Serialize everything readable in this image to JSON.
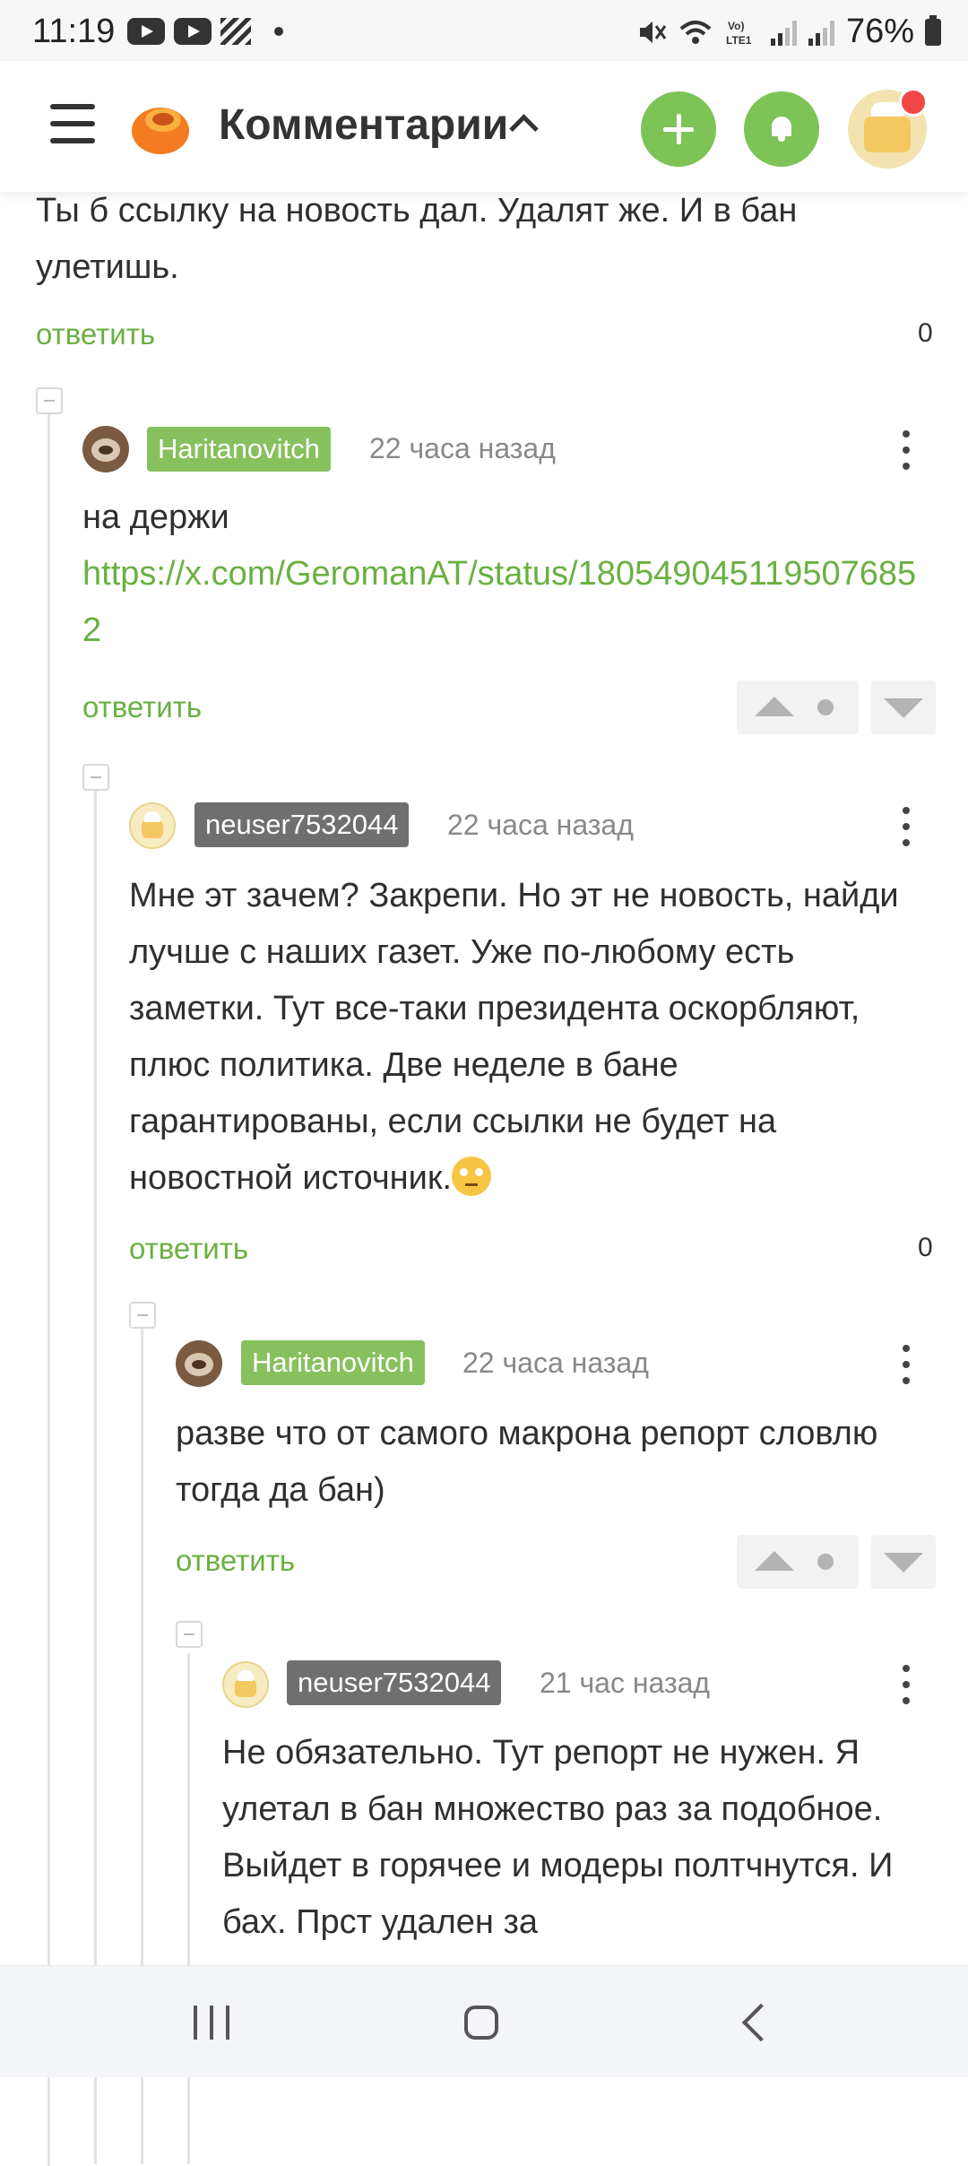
{
  "status_bar": {
    "time": "11:19",
    "battery": "76%"
  },
  "header": {
    "title": "Комментарии"
  },
  "comments": [
    {
      "text": "Ты б ссылку на новость дал. Удалят же. И в бан улетишь.",
      "reply_label": "ответить",
      "score": "0"
    },
    {
      "author": "Haritanovitch",
      "time": "22 часа назад",
      "text": "на держи",
      "link": "https://x.com/GeromanAT/status/1805490451195076852",
      "reply_label": "ответить"
    },
    {
      "author": "neuser7532044",
      "time": "22 часа назад",
      "text": "Мне эт зачем? Закрепи. Но эт не новость, найди лучше с наших газет. Уже по-любому есть заметки. Тут все-таки президента оскорбляют, плюс политика. Две неделе в бане гарантированы, если ссылки не будет на новостной источник.",
      "emoji": "face-with-rolling-eyes",
      "reply_label": "ответить",
      "score": "0"
    },
    {
      "author": "Haritanovitch",
      "time": "22 часа назад",
      "text": "разве что от самого макрона репорт словлю тогда да бан)",
      "reply_label": "ответить"
    },
    {
      "author": "neuser7532044",
      "time": "21 час назад",
      "text": "Не обязательно. Тут репорт не нужен. Я улетал в бан множество раз за подобное. Выйдет в горячее и модеры полтчнутся. И бах. Прст удален за"
    }
  ],
  "colors": {
    "accent_green": "#7ec356",
    "link_green": "#6ab042",
    "notification_red": "#f04646"
  }
}
